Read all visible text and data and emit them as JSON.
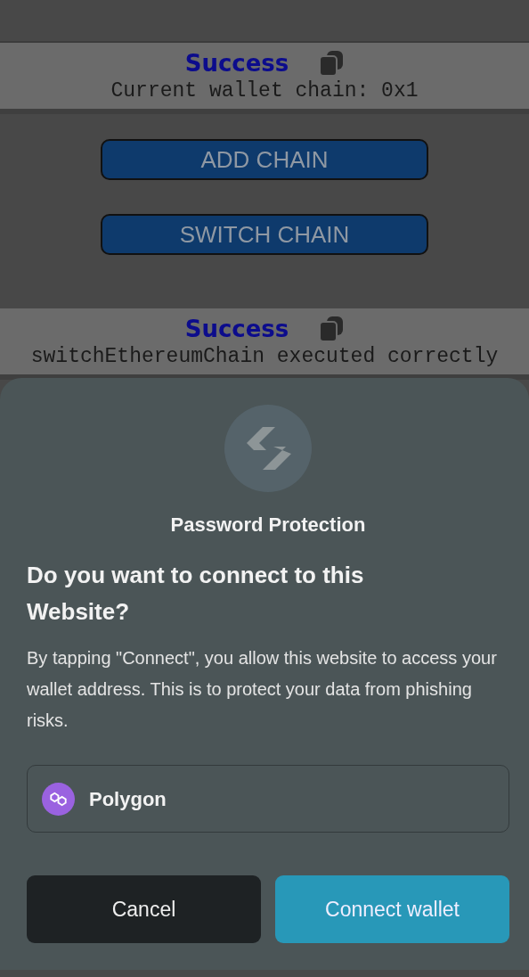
{
  "status_panels": [
    {
      "title": "Success",
      "message": "Current wallet chain: 0x1"
    },
    {
      "title": "Success",
      "message": "switchEthereumChain executed correctly"
    }
  ],
  "chain_buttons": [
    {
      "label": "ADD CHAIN"
    },
    {
      "label": "SWITCH CHAIN"
    }
  ],
  "dialog": {
    "title": "Password Protection",
    "heading": "Do you want to connect to this Website?",
    "body": "By tapping \"Connect\", you allow this website to access your wallet address. This is to protect your data from phishing risks.",
    "network": {
      "name": "Polygon"
    },
    "actions": [
      {
        "label": "Cancel",
        "kind": "secondary"
      },
      {
        "label": "Connect wallet",
        "kind": "primary"
      }
    ]
  }
}
